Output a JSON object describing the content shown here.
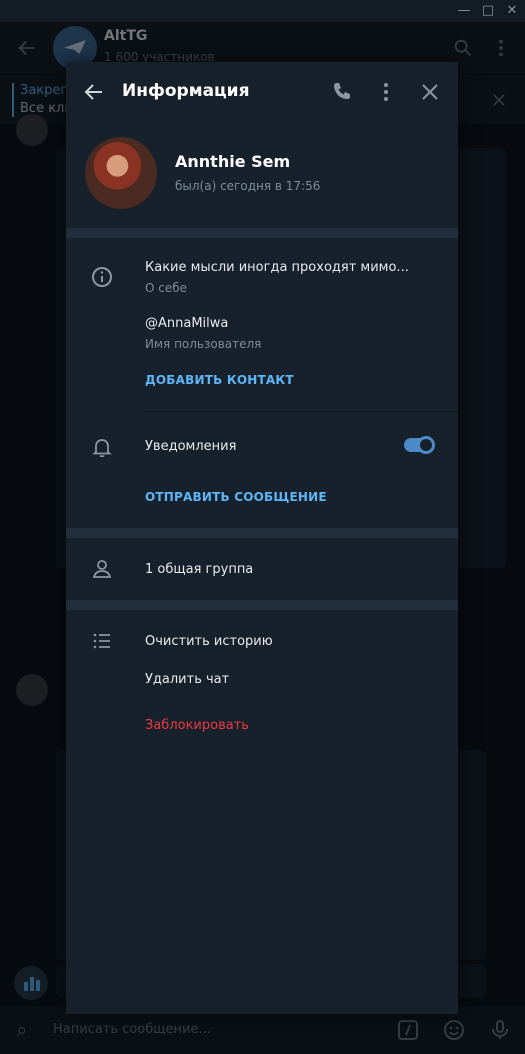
{
  "chat": {
    "title": "AltTG",
    "subtitle": "1 600 участников",
    "pinned_title": "Закреп",
    "pinned_text": "Все кли",
    "compose_placeholder": "Написать сообщение..."
  },
  "panel": {
    "title": "Информация",
    "user": {
      "name": "Annthie Sem",
      "status": "был(а) сегодня в 17:56"
    },
    "bio": {
      "value": "Какие мысли иногда проходят мимо...",
      "label": "О себе"
    },
    "username": {
      "value": "@AnnaMilwa",
      "label": "Имя пользователя"
    },
    "add_contact": "ДОБАВИТЬ КОНТАКТ",
    "notifications": {
      "label": "Уведомления",
      "enabled": true
    },
    "send_message": "ОТПРАВИТЬ СООБЩЕНИЕ",
    "groups": "1 общая группа",
    "actions": {
      "clear_history": "Очистить историю",
      "delete_chat": "Удалить чат",
      "block": "Заблокировать"
    }
  },
  "colors": {
    "accent": "#5eb5f7",
    "danger": "#ec3942",
    "toggle_on": "#4e8ac8",
    "panel_bg": "#17212b"
  }
}
